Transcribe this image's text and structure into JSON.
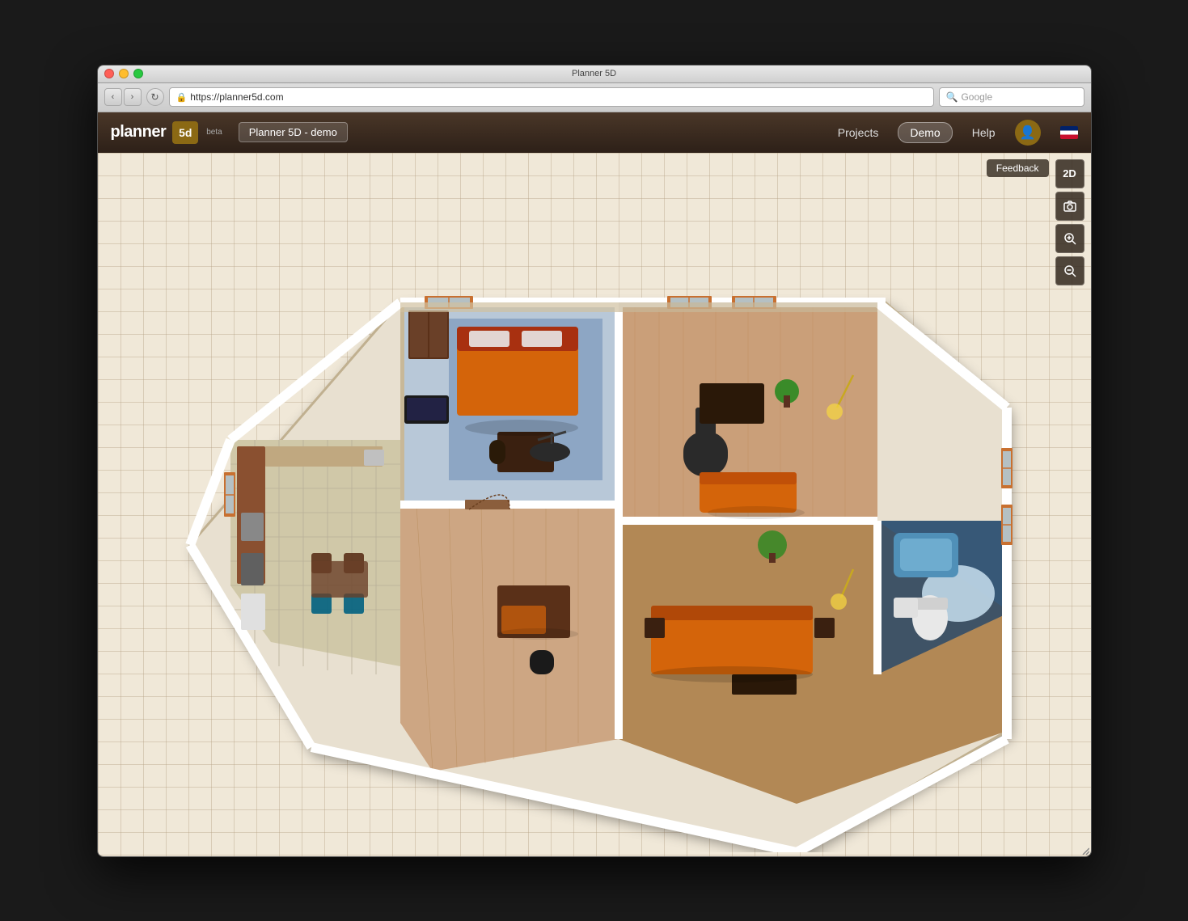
{
  "window": {
    "title": "Planner 5D"
  },
  "browser": {
    "url": "https://planner5d.com",
    "search_placeholder": "Google"
  },
  "navbar": {
    "logo_text": "planner",
    "logo_box": "5d",
    "beta_label": "beta",
    "project_name": "Planner 5D - demo",
    "nav_items": [
      "Projects",
      "Demo",
      "Help"
    ],
    "active_nav": "Demo",
    "flag": "UK"
  },
  "toolbar": {
    "feedback_label": "Feedback",
    "view_2d_label": "2D",
    "screenshot_icon": "camera-icon",
    "zoom_in_icon": "zoom-in-icon",
    "zoom_out_icon": "zoom-out-icon"
  },
  "colors": {
    "bg_grid": "#f0e8d8",
    "navbar_dark": "#2d2018",
    "wall_color": "#e8e0d0",
    "floor_wood": "#c4936a",
    "floor_tile": "#d8d0b8",
    "floor_blue_carpet": "#7090b8",
    "furniture_orange": "#d4640a",
    "furniture_dark": "#3a2010",
    "window_frame": "#c87030",
    "bathroom_blue": "#5090b8"
  }
}
